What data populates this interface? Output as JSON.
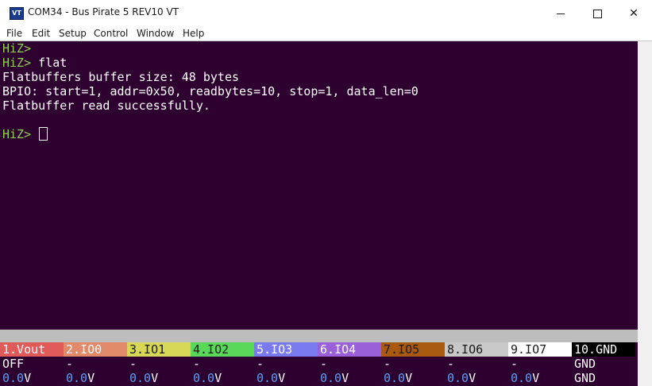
{
  "window": {
    "title": "COM34 - Bus Pirate 5 REV10 VT",
    "icon": "vt-terminal-icon",
    "icon_text": "VT"
  },
  "menu": [
    "File",
    "Edit",
    "Setup",
    "Control",
    "Window",
    "Help"
  ],
  "terminal": {
    "lines": [
      {
        "prompt": "HiZ>",
        "text": ""
      },
      {
        "prompt": "HiZ>",
        "text": " flat"
      },
      {
        "prompt": "",
        "text": "Flatbuffers buffer size: 48 bytes"
      },
      {
        "prompt": "",
        "text": "BPIO: start=1, addr=0x50, readbytes=10, stop=1, data_len=0"
      },
      {
        "prompt": "",
        "text": "Flatbuffer read successfully."
      },
      {
        "prompt": "",
        "text": ""
      },
      {
        "prompt": "HiZ>",
        "text": " "
      }
    ]
  },
  "pins": [
    {
      "label": "1.Vout",
      "state": "OFF",
      "volt": "0.0",
      "unit": "V",
      "color": "#e05a5a"
    },
    {
      "label": "2.IO0",
      "state": "-",
      "volt": "0.0",
      "unit": "V",
      "color": "#e08a6a"
    },
    {
      "label": "3.IO1",
      "state": "-",
      "volt": "0.0",
      "unit": "V",
      "color": "#d8d858"
    },
    {
      "label": "4.IO2",
      "state": "-",
      "volt": "0.0",
      "unit": "V",
      "color": "#5ad85a"
    },
    {
      "label": "5.IO3",
      "state": "-",
      "volt": "0.0",
      "unit": "V",
      "color": "#7a7aef"
    },
    {
      "label": "6.IO4",
      "state": "-",
      "volt": "0.0",
      "unit": "V",
      "color": "#9a60d8"
    },
    {
      "label": "7.IO5",
      "state": "-",
      "volt": "0.0",
      "unit": "V",
      "color": "#a85a10"
    },
    {
      "label": "8.IO6",
      "state": "-",
      "volt": "0.0",
      "unit": "V",
      "color": "#c8c8c8"
    },
    {
      "label": "9.IO7",
      "state": "-",
      "volt": "0.0",
      "unit": "V",
      "color": "#ffffff"
    },
    {
      "label": "10.GND",
      "state": "GND",
      "volt": "GND",
      "unit": "",
      "color": "#000000"
    }
  ],
  "colors": {
    "terminal_bg": "#2d0030",
    "prompt": "#8fd14f",
    "voltage": "#5aa0f0"
  }
}
